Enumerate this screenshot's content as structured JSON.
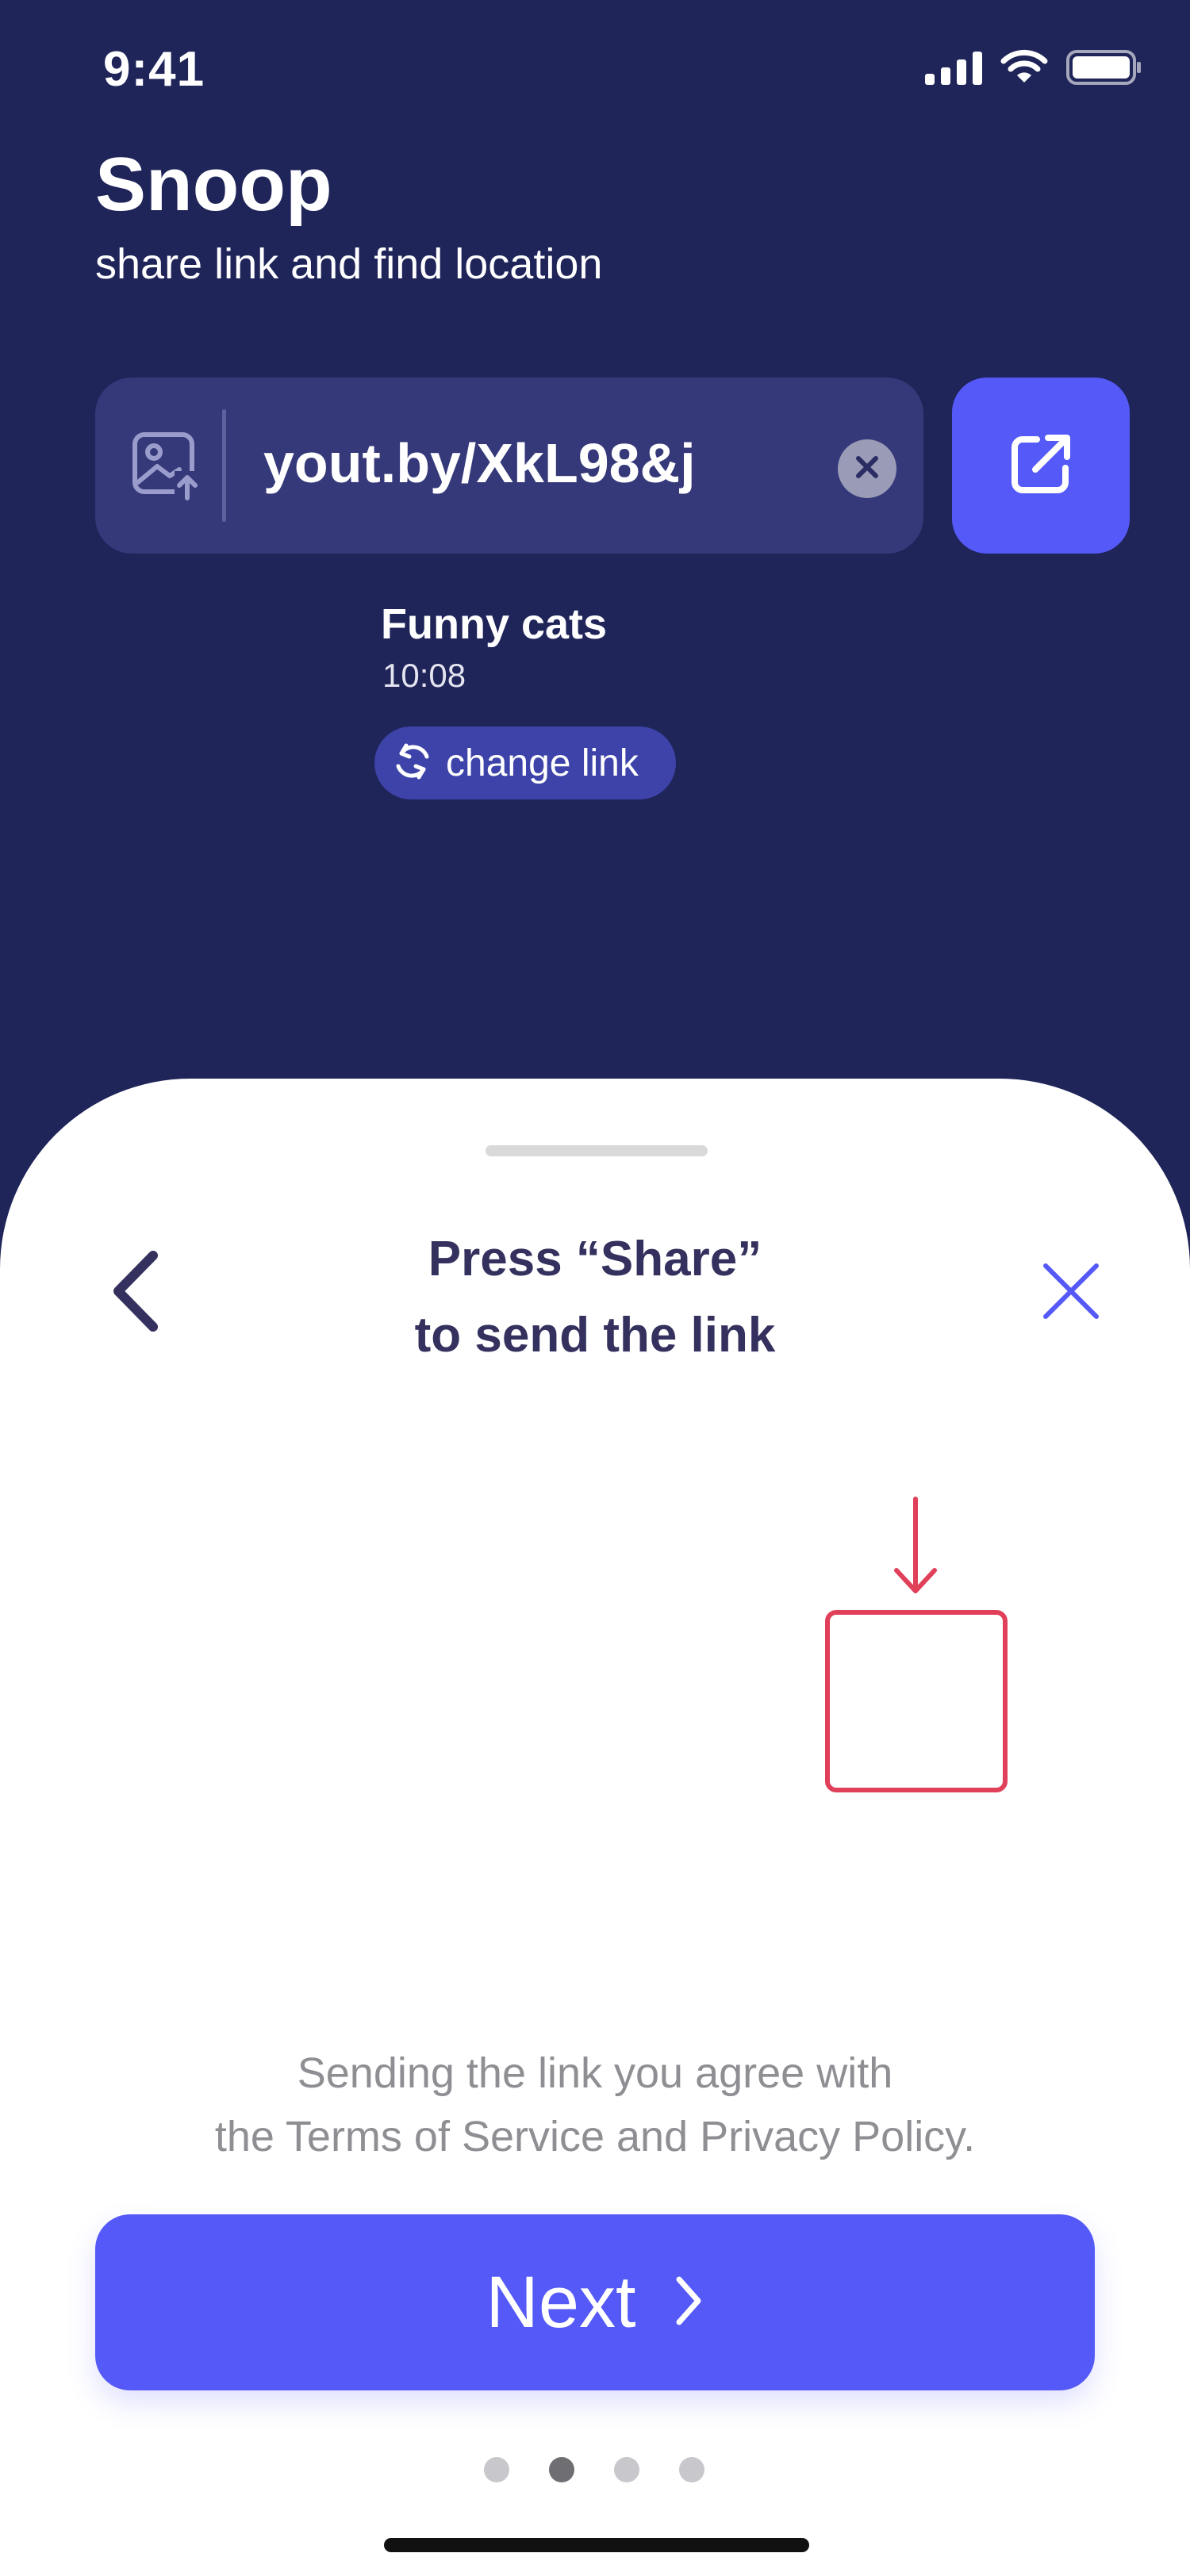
{
  "status_bar": {
    "time": "9:41",
    "icons": [
      "cellular-signal-icon",
      "wifi-icon",
      "battery-icon"
    ]
  },
  "header": {
    "title": "Snoop",
    "subtitle": "share link and find location"
  },
  "link_field": {
    "value": "yout.by/XkL98&j",
    "leading_icon": "image-upload-icon",
    "clear_icon": "clear-icon",
    "share_icon": "open-external-icon"
  },
  "video": {
    "title": "Funny cats",
    "time": "10:08",
    "change_link_label": "change link",
    "change_link_icon": "refresh-icon"
  },
  "sheet": {
    "title_line1": "Press “Share”",
    "title_line2": "to send the link",
    "terms_line1": "Sending the link you agree with",
    "terms_line2": "the Terms of Service and Privacy Policy.",
    "next_label": "Next",
    "pager": {
      "total": 4,
      "active_index": 1
    }
  },
  "colors": {
    "background": "#1f2459",
    "accent": "#5459f7",
    "field": "#35397a",
    "highlight": "#e0405a",
    "sheet_title": "#34315e"
  }
}
